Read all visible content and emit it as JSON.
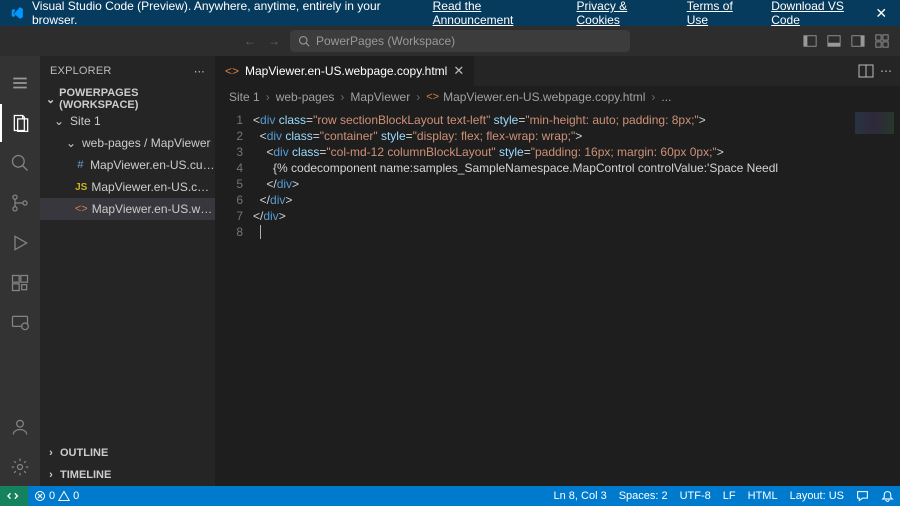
{
  "banner": {
    "text": "Visual Studio Code (Preview). Anywhere, anytime, entirely in your browser.",
    "links": [
      "Read the Announcement",
      "Privacy & Cookies",
      "Terms of Use",
      "Download VS Code"
    ]
  },
  "commandBar": {
    "placeholder": "PowerPages (Workspace)"
  },
  "sidebar": {
    "title": "EXPLORER",
    "workspaceSection": "POWERPAGES (WORKSPACE)",
    "tree": {
      "site": "Site 1",
      "folderPath": "web-pages / MapViewer",
      "files": [
        {
          "icon": "hash",
          "name": "MapViewer.en-US.customc..."
        },
        {
          "icon": "js",
          "name": "MapViewer.en-US.customj..."
        },
        {
          "icon": "code",
          "name": "MapViewer.en-US.webpag..."
        }
      ]
    },
    "bottomSections": [
      "OUTLINE",
      "TIMELINE"
    ]
  },
  "editor": {
    "tab": {
      "icon": "code",
      "label": "MapViewer.en-US.webpage.copy.html"
    },
    "breadcrumb": [
      "Site 1",
      "web-pages",
      "MapViewer",
      "MapViewer.en-US.webpage.copy.html",
      "..."
    ],
    "lineCount": 8,
    "code": {
      "l1": {
        "cls": "row sectionBlockLayout text-left",
        "style": "min-height: auto; padding: 8px;"
      },
      "l2": {
        "cls": "container",
        "style": "display: flex; flex-wrap: wrap;"
      },
      "l3": {
        "cls": "col-md-12 columnBlockLayout",
        "style": "padding: 16px; margin: 60px 0px;"
      },
      "l4": "{% codecomponent name:samples_SampleNamespace.MapControl controlValue:'Space Needl"
    }
  },
  "status": {
    "errors": "0",
    "warnings": "0",
    "cursor": "Ln 8, Col 3",
    "spaces": "Spaces: 2",
    "encoding": "UTF-8",
    "eol": "LF",
    "lang": "HTML",
    "layout": "Layout: US"
  }
}
